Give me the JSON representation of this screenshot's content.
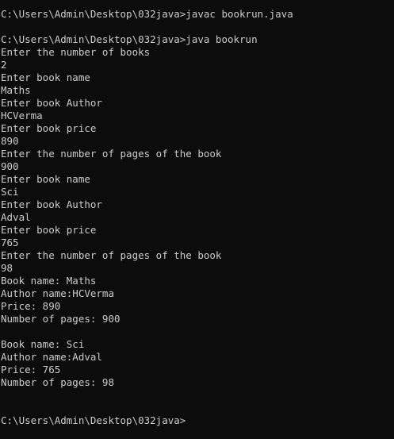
{
  "colors": {
    "background": "#0c0c0c",
    "text": "#cccccc"
  },
  "console": {
    "lines": [
      "C:\\Users\\Admin\\Desktop\\032java>javac bookrun.java",
      "",
      "C:\\Users\\Admin\\Desktop\\032java>java bookrun",
      "Enter the number of books",
      "2",
      "Enter book name",
      "Maths",
      "Enter book Author",
      "HCVerma",
      "Enter book price",
      "890",
      "Enter the number of pages of the book",
      "900",
      "Enter book name",
      "Sci",
      "Enter book Author",
      "Adval",
      "Enter book price",
      "765",
      "Enter the number of pages of the book",
      "98",
      "Book name: Maths",
      "Author name:HCVerma",
      "Price: 890",
      "Number of pages: 900",
      "",
      "Book name: Sci",
      "Author name:Adval",
      "Price: 765",
      "Number of pages: 98",
      "",
      "",
      "C:\\Users\\Admin\\Desktop\\032java>"
    ]
  }
}
